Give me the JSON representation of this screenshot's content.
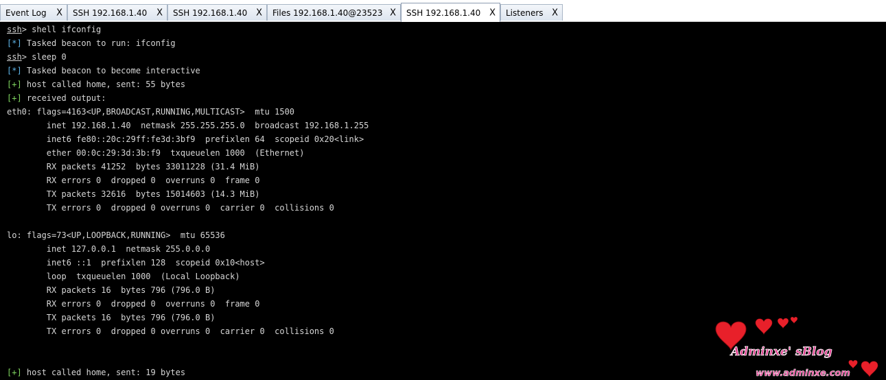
{
  "tabs": [
    {
      "label": "Event Log",
      "close": "X"
    },
    {
      "label": "SSH 192.168.1.40",
      "close": "X"
    },
    {
      "label": "SSH 192.168.1.40",
      "close": "X"
    },
    {
      "label": "Files 192.168.1.40@23523",
      "close": "X"
    },
    {
      "label": "SSH 192.168.1.40",
      "close": "X",
      "active": true
    },
    {
      "label": "Listeners",
      "close": "X"
    }
  ],
  "console": {
    "lines": [
      {
        "prompt": "ssh",
        "text": "> shell ifconfig"
      },
      {
        "marker": "[*]",
        "text": " Tasked beacon to run: ifconfig"
      },
      {
        "prompt": "ssh",
        "text": "> sleep 0"
      },
      {
        "marker": "[*]",
        "text": " Tasked beacon to become interactive"
      },
      {
        "marker": "[+]",
        "text": " host called home, sent: 55 bytes"
      },
      {
        "marker": "[+]",
        "text": " received output:"
      },
      {
        "text": "eth0: flags=4163<UP,BROADCAST,RUNNING,MULTICAST>  mtu 1500"
      },
      {
        "text": "        inet 192.168.1.40  netmask 255.255.255.0  broadcast 192.168.1.255"
      },
      {
        "text": "        inet6 fe80::20c:29ff:fe3d:3bf9  prefixlen 64  scopeid 0x20<link>"
      },
      {
        "text": "        ether 00:0c:29:3d:3b:f9  txqueuelen 1000  (Ethernet)"
      },
      {
        "text": "        RX packets 41252  bytes 33011228 (31.4 MiB)"
      },
      {
        "text": "        RX errors 0  dropped 0  overruns 0  frame 0"
      },
      {
        "text": "        TX packets 32616  bytes 15014603 (14.3 MiB)"
      },
      {
        "text": "        TX errors 0  dropped 0 overruns 0  carrier 0  collisions 0"
      },
      {
        "text": ""
      },
      {
        "text": "lo: flags=73<UP,LOOPBACK,RUNNING>  mtu 65536"
      },
      {
        "text": "        inet 127.0.0.1  netmask 255.0.0.0"
      },
      {
        "text": "        inet6 ::1  prefixlen 128  scopeid 0x10<host>"
      },
      {
        "text": "        loop  txqueuelen 1000  (Local Loopback)"
      },
      {
        "text": "        RX packets 16  bytes 796 (796.0 B)"
      },
      {
        "text": "        RX errors 0  dropped 0  overruns 0  frame 0"
      },
      {
        "text": "        TX packets 16  bytes 796 (796.0 B)"
      },
      {
        "text": "        TX errors 0  dropped 0 overruns 0  carrier 0  collisions 0"
      },
      {
        "text": ""
      },
      {
        "text": ""
      },
      {
        "marker": "[+]",
        "text": " host called home, sent: 19 bytes"
      }
    ]
  },
  "watermark": {
    "title": "Adminxe' sBlog",
    "url": "www.adminxe.com"
  },
  "colors": {
    "info_marker": "#5fb4e8",
    "ok_marker": "#7fd55f",
    "console_text": "#d6d6d6",
    "console_bg": "#000000",
    "heart": "#e8202a"
  }
}
